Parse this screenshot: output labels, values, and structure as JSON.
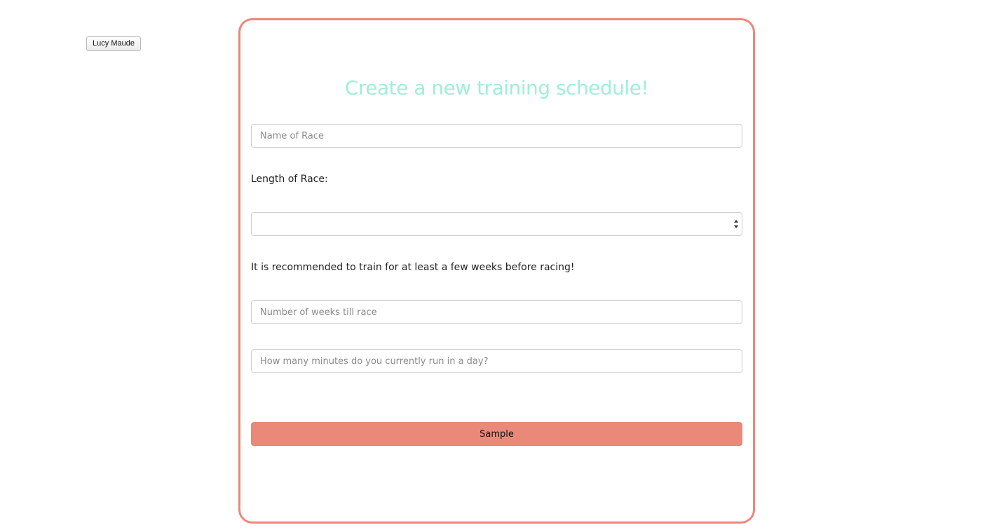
{
  "user": {
    "button_label": "Lucy Maude"
  },
  "form": {
    "title": "Create a new training schedule!",
    "race_name_placeholder": "Name of Race",
    "length_label": "Length of Race:",
    "length_selected": "",
    "recommendation_text": "It is recommended to train for at least a few weeks before racing!",
    "weeks_placeholder": "Number of weeks till race",
    "minutes_placeholder": "How many minutes do you currently run in a day?",
    "submit_label": "Sample"
  },
  "colors": {
    "card_border": "#e9897b",
    "title": "#9ef0d3",
    "button": "#ea887a"
  },
  "icons": {
    "select_arrows": "chevron-up-down-icon"
  }
}
